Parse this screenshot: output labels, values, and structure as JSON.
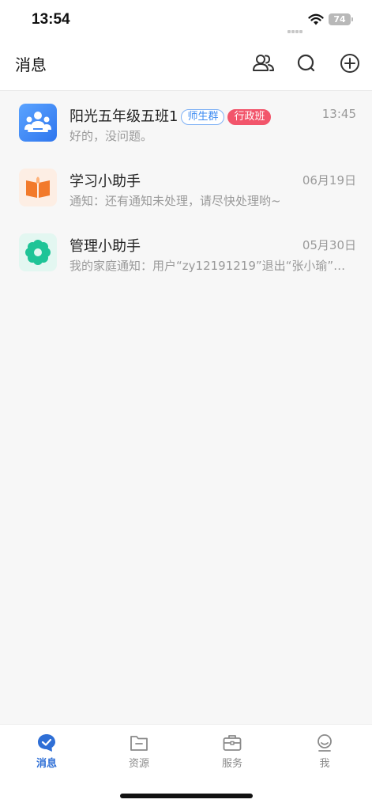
{
  "status_bar": {
    "time": "13:54",
    "battery": "74"
  },
  "header": {
    "title": "消息"
  },
  "conversations": [
    {
      "name": "阳光五年级五班1",
      "tags": [
        "师生群",
        "行政班"
      ],
      "time": "13:45",
      "preview": "好的，没问题。",
      "icon": "group-people-icon"
    },
    {
      "name": "学习小助手",
      "time": "06月19日",
      "preview": "通知：还有通知未处理，请尽快处理哟~",
      "icon": "book-icon"
    },
    {
      "name": "管理小助手",
      "time": "05月30日",
      "preview": "我的家庭通知：用户“zy12191219”退出“张小瑜”…",
      "icon": "gear-flower-icon"
    }
  ],
  "tabs": [
    {
      "label": "消息",
      "icon": "message-icon",
      "active": true
    },
    {
      "label": "资源",
      "icon": "folder-icon",
      "active": false
    },
    {
      "label": "服务",
      "icon": "briefcase-icon",
      "active": false
    },
    {
      "label": "我",
      "icon": "profile-icon",
      "active": false
    }
  ],
  "colors": {
    "accent": "#2f6fd6",
    "tag_blue": "#3d8bf2",
    "tag_red": "#f2556b"
  }
}
